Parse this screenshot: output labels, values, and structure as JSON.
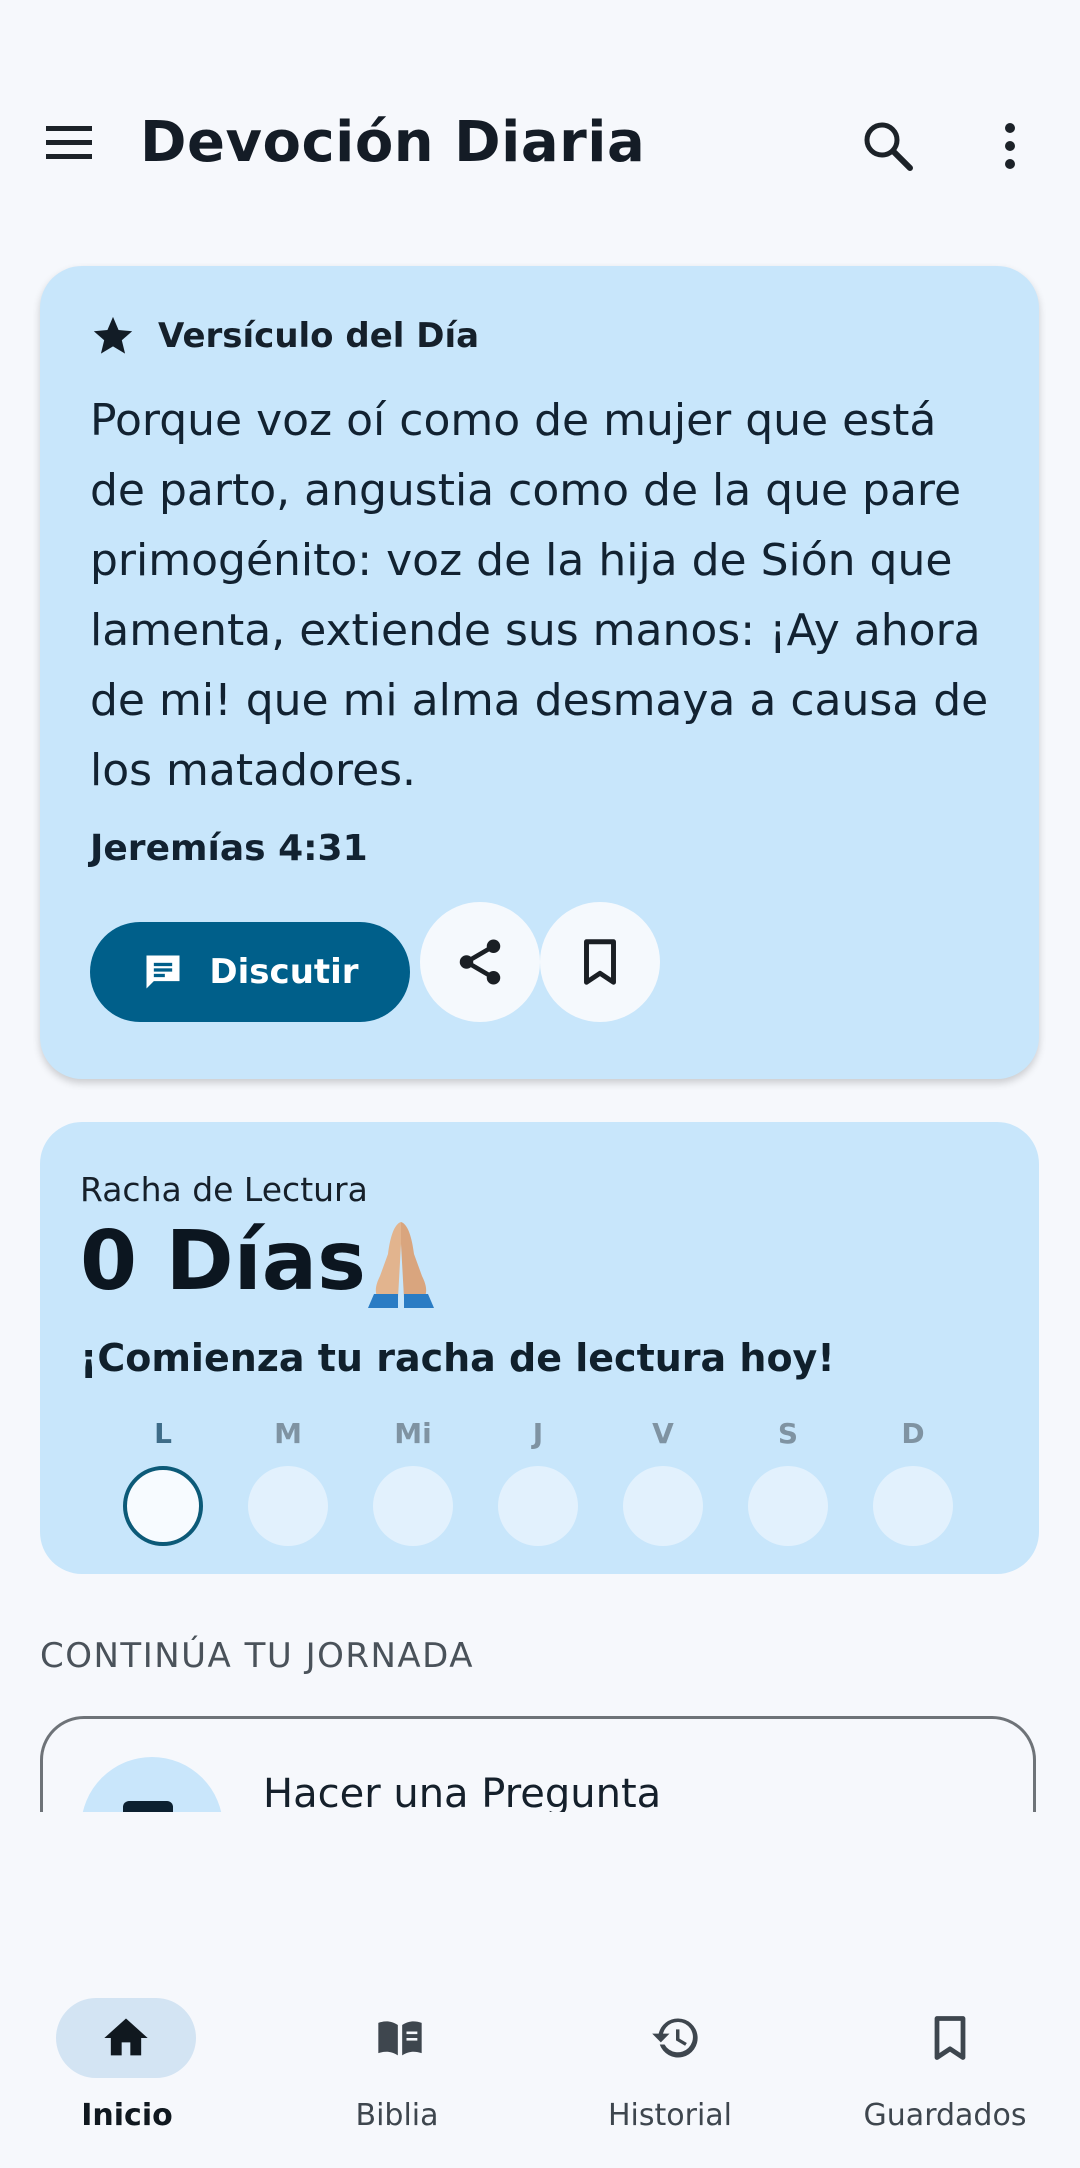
{
  "app": {
    "title": "Devoción Diaria",
    "icons": {
      "menu": "menu-icon",
      "search": "search-icon",
      "more": "more-vert-icon"
    }
  },
  "verse_card": {
    "badge": "Versículo del Día",
    "text": "Porque voz oí como de mujer que está de parto, angustia como de la que pare primogénito: voz de la hija de Sión que lamenta, extiende sus manos: ¡Ay ahora de mi! que mi alma desmaya a causa de los matadores.",
    "reference": "Jeremías 4:31",
    "discuss_label": "Discutir"
  },
  "streak": {
    "label": "Racha de Lectura",
    "count": "0 Días",
    "cta": "¡Comienza tu racha de lectura hoy!",
    "days": [
      "L",
      "M",
      "Mi",
      "J",
      "V",
      "S",
      "D"
    ],
    "active_day": "L"
  },
  "journey": {
    "section_title": "CONTINÚA TU JORNADA",
    "items": [
      {
        "title": "Hacer una Pregunta"
      }
    ]
  },
  "bottom_nav": {
    "items": [
      {
        "label": "Inicio",
        "icon": "home-icon",
        "active": true
      },
      {
        "label": "Biblia",
        "icon": "book-icon",
        "active": false
      },
      {
        "label": "Historial",
        "icon": "history-icon",
        "active": false
      },
      {
        "label": "Guardados",
        "icon": "bookmark-icon",
        "active": false
      }
    ]
  },
  "colors": {
    "background": "#f6f8fc",
    "card": "#c8e6fb",
    "primary_button": "#005f8a",
    "nav_active_pill": "#d3e4f3"
  }
}
